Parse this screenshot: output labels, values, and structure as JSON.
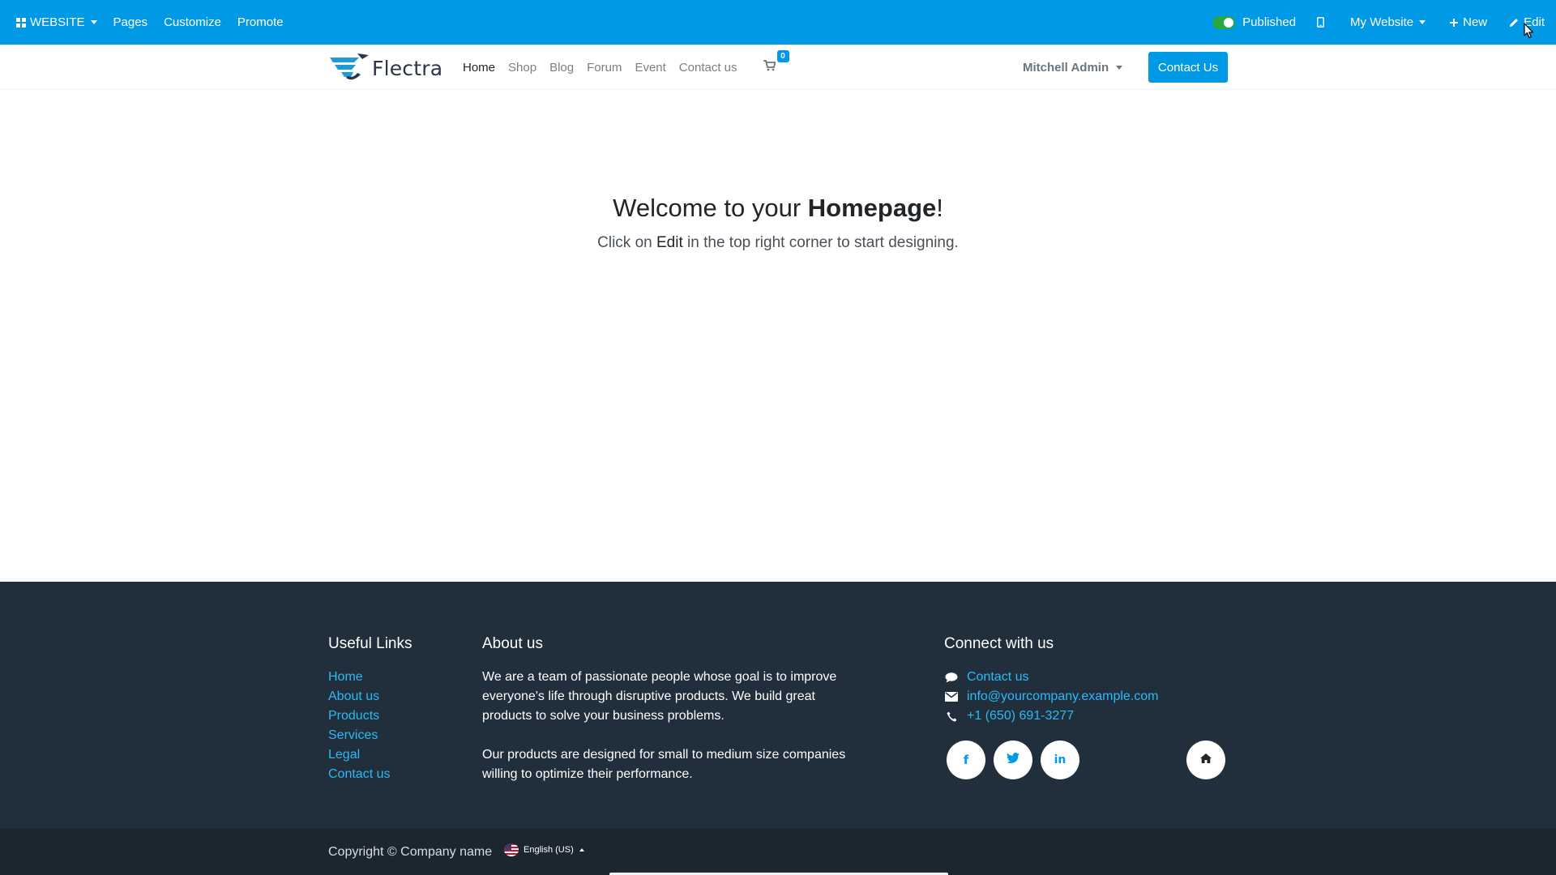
{
  "adminbar": {
    "website_label": "WEBSITE",
    "pages_label": "Pages",
    "customize_label": "Customize",
    "promote_label": "Promote",
    "published_label": "Published",
    "website_selector_label": "My Website",
    "new_label": "New",
    "edit_label": "Edit",
    "published": true
  },
  "header": {
    "logo_text": "Flectra",
    "nav": [
      "Home",
      "Shop",
      "Blog",
      "Forum",
      "Event",
      "Contact us"
    ],
    "active_nav": "Home",
    "cart_count": "0",
    "user_name": "Mitchell Admin",
    "contact_button": "Contact Us"
  },
  "main": {
    "welcome_prefix": "Welcome to your ",
    "welcome_strong": "Homepage",
    "welcome_suffix": "!",
    "sub_prefix": "Click on ",
    "sub_strong": "Edit",
    "sub_suffix": " in the top right corner to start designing."
  },
  "footer": {
    "useful_links_title": "Useful Links",
    "useful_links": [
      "Home",
      "About us",
      "Products",
      "Services",
      "Legal",
      "Contact us"
    ],
    "about_title": "About us",
    "about_p1": "We are a team of passionate people whose goal is to improve everyone's life through disruptive products. We build great products to solve your business problems.",
    "about_p2": "Our products are designed for small to medium size companies willing to optimize their performance.",
    "connect_title": "Connect with us",
    "contact_link": "Contact us",
    "email": "info@yourcompany.example.com",
    "phone": "+1 (650) 691-3277",
    "social": [
      "facebook-icon",
      "twitter-icon",
      "linkedin-icon",
      "home-icon"
    ]
  },
  "bottombar": {
    "copyright": "Copyright © Company name",
    "language": "English (US)"
  },
  "colors": {
    "primary": "#0099e6",
    "footer_bg": "#212f3d",
    "bottom_bg": "#1b2631",
    "link": "#2eb8f5",
    "published_toggle": "#28a745"
  }
}
